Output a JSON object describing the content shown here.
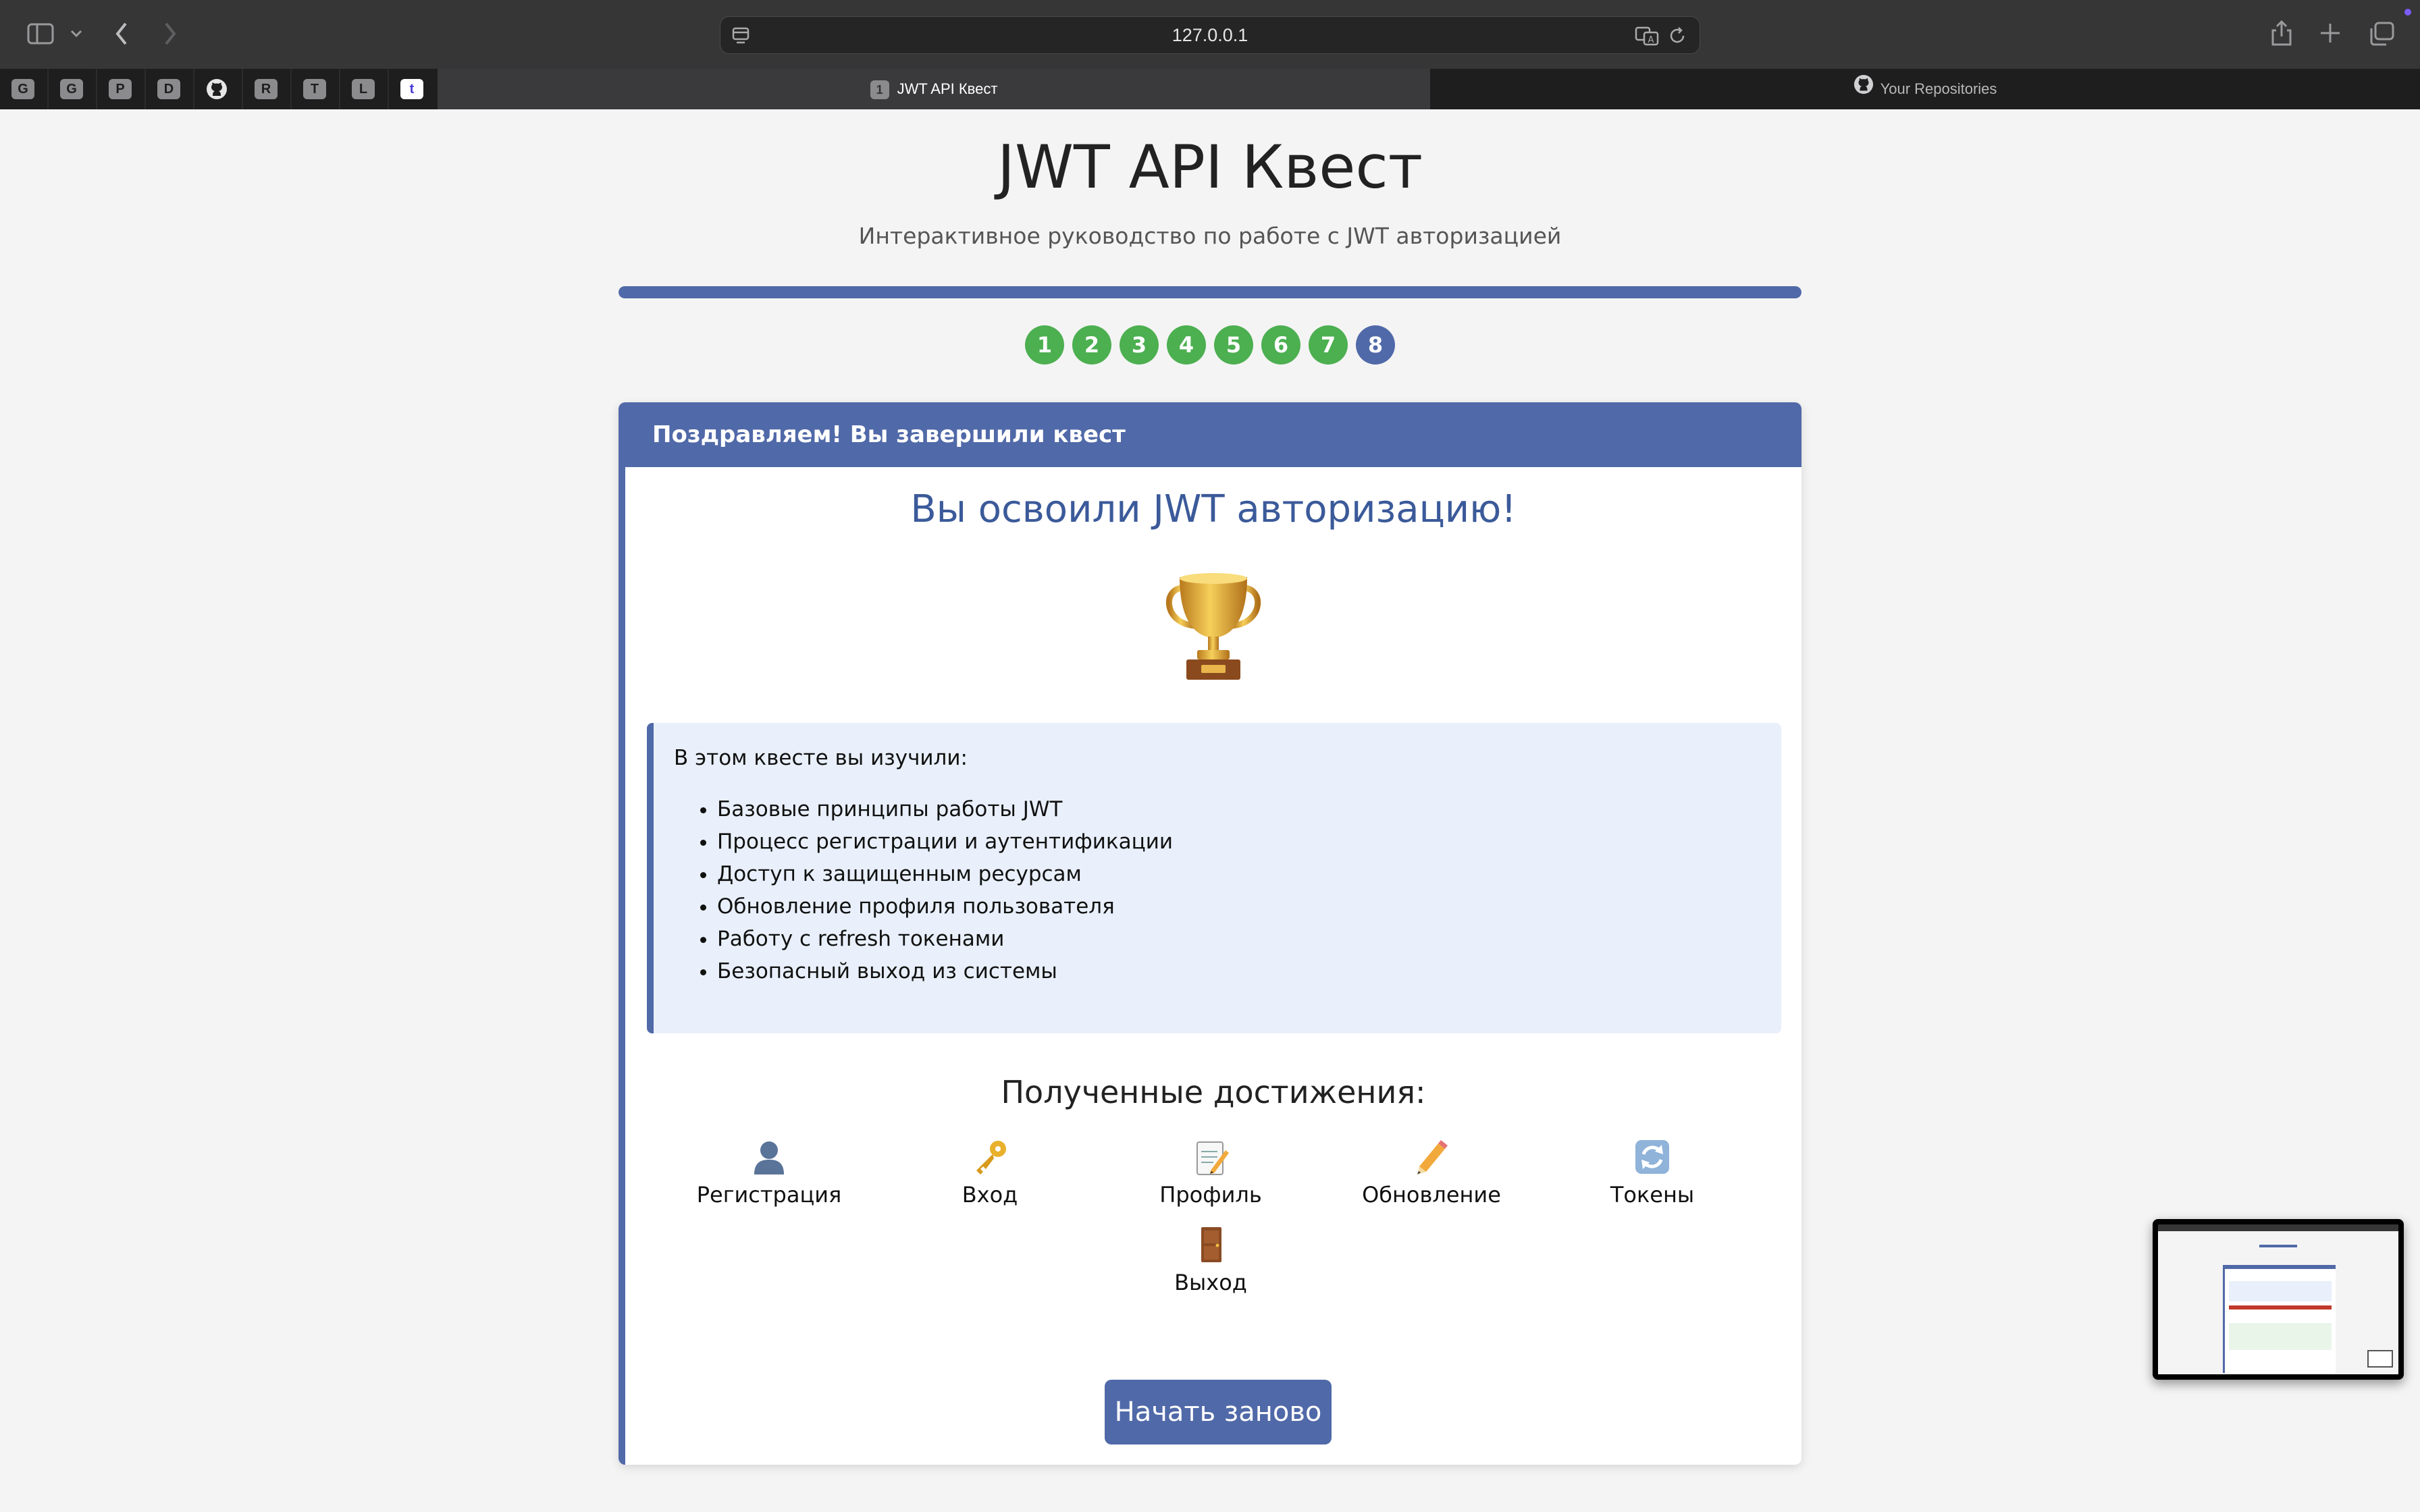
{
  "browser": {
    "url": "127.0.0.1",
    "pinned_tabs": [
      "G",
      "G",
      "P",
      "D",
      "github",
      "R",
      "T",
      "L",
      "t"
    ],
    "tabs": [
      {
        "label": "JWT API Квест",
        "favicon": "1",
        "active": true
      },
      {
        "label": "Your Repositories",
        "favicon": "github",
        "active": false
      }
    ]
  },
  "page": {
    "title": "JWT API Квест",
    "subtitle": "Интерактивное руководство по работе с JWT авторизацией",
    "progress": 1.0,
    "steps": [
      "1",
      "2",
      "3",
      "4",
      "5",
      "6",
      "7",
      "8"
    ],
    "current_step": 8
  },
  "card": {
    "header": "Поздравляем! Вы завершили квест",
    "heading": "Вы освоили JWT авторизацию!",
    "trophy_icon": "trophy-icon",
    "info_intro": "В этом квесте вы изучили:",
    "topics": [
      "Базовые принципы работы JWT",
      "Процесс регистрации и аутентификации",
      "Доступ к защищенным ресурсам",
      "Обновление профиля пользователя",
      "Работу с refresh токенами",
      "Безопасный выход из системы"
    ],
    "achievements_heading": "Полученные достижения:",
    "achievements": [
      {
        "icon": "user-icon",
        "label": "Регистрация"
      },
      {
        "icon": "key-icon",
        "label": "Вход"
      },
      {
        "icon": "memo-icon",
        "label": "Профиль"
      },
      {
        "icon": "pencil-icon",
        "label": "Обновление"
      },
      {
        "icon": "refresh-icon",
        "label": "Токены"
      },
      {
        "icon": "door-icon",
        "label": "Выход"
      }
    ],
    "restart_label": "Начать заново"
  },
  "colors": {
    "accent": "#5069a8",
    "step_done": "#4caf50",
    "info_bg": "#e9f0fb"
  }
}
